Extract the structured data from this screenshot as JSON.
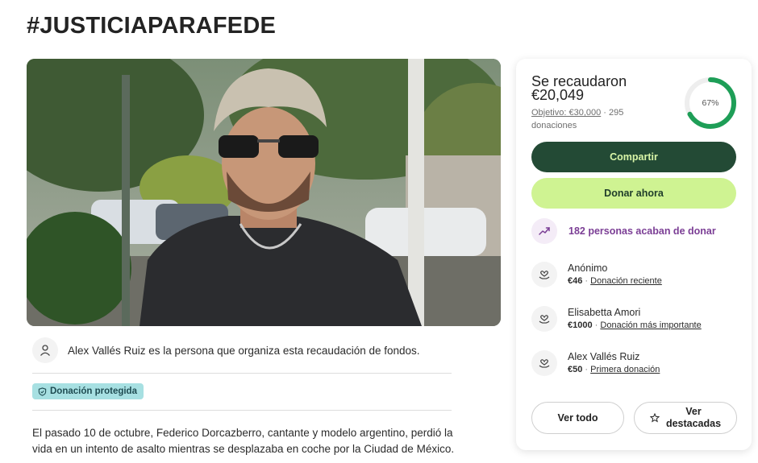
{
  "page": {
    "title": "#JUSTICIAPARAFEDE"
  },
  "organizer": {
    "text": "Alex Vallés Ruiz es la persona que organiza esta recaudación de fondos."
  },
  "badge": {
    "label": "Donación protegida"
  },
  "story": {
    "text": "El pasado 10 de octubre, Federico Dorcazberro, cantante y modelo argentino, perdió la vida en un intento de asalto mientras se desplazaba en coche por la Ciudad de México."
  },
  "summary": {
    "raised_label": "Se recaudaron",
    "raised_amount": "€20,049",
    "goal": "Objetivo: €30,000",
    "separator": "·",
    "donations_count": "295",
    "donations_word": "donaciones",
    "progress_percent": 67,
    "progress_label": "67%",
    "ring_color": "#1e9e57"
  },
  "actions": {
    "share": "Compartir",
    "donate": "Donar ahora"
  },
  "recent": {
    "text": "182 personas acaban de donar"
  },
  "donors": [
    {
      "name": "Anónimo",
      "amount": "€46",
      "kind": "Donación reciente"
    },
    {
      "name": "Elisabetta Amori",
      "amount": "€1000",
      "kind": "Donación más importante"
    },
    {
      "name": "Alex Vallés Ruiz",
      "amount": "€50",
      "kind": "Primera donación"
    }
  ],
  "footer": {
    "see_all": "Ver todo",
    "see_featured_line1": "Ver",
    "see_featured_line2": "destacadas"
  },
  "icons": {
    "organizer": "person-icon",
    "badge": "shield-icon",
    "recent": "trend-up-icon",
    "donor": "heart-hand-icon",
    "featured": "star-icon"
  },
  "colors": {
    "share_bg": "#234a35",
    "share_text": "#d9f5a8",
    "donate_bg": "#cff392",
    "recent_text": "#7b3e95",
    "badge_bg": "#a7e0e2"
  }
}
